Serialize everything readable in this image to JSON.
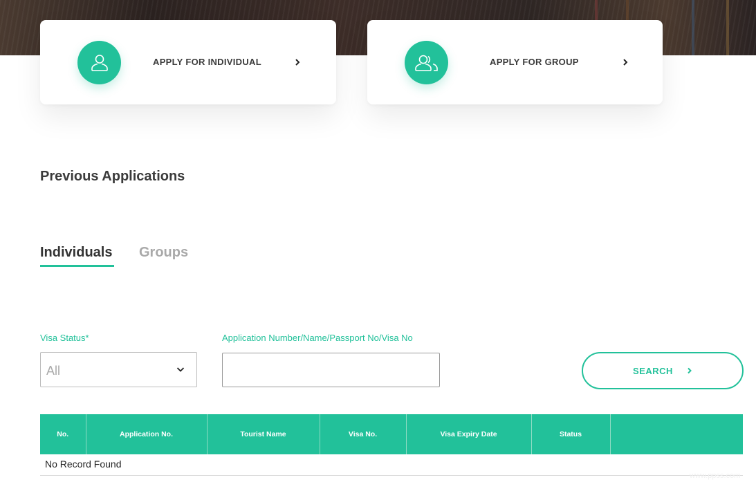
{
  "cards": {
    "individual": {
      "label": "APPLY FOR INDIVIDUAL",
      "icon": "user-icon"
    },
    "group": {
      "label": "APPLY FOR GROUP",
      "icon": "users-icon"
    }
  },
  "section": {
    "title": "Previous Applications"
  },
  "tabs": [
    {
      "label": "Individuals",
      "active": true
    },
    {
      "label": "Groups",
      "active": false
    }
  ],
  "filters": {
    "visa_status": {
      "label": "Visa Status*",
      "value": "All"
    },
    "search_field": {
      "label": "Application Number/Name/Passport No/Visa No",
      "value": ""
    },
    "search_button": "SEARCH"
  },
  "table": {
    "columns": [
      "No.",
      "Application No.",
      "Tourist Name",
      "Visa No.",
      "Visa Expiry Date",
      "Status",
      ""
    ],
    "empty_message": "No Record Found"
  },
  "watermark": "www.ppss.com",
  "colors": {
    "accent": "#22c19a",
    "tab_inactive": "#a9a9a9"
  }
}
